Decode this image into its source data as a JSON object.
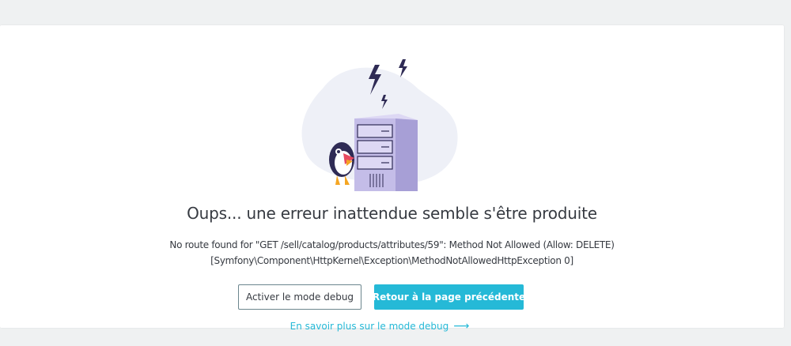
{
  "error": {
    "title": "Oups... une erreur inattendue semble s'être produite",
    "message_line1": "No route found for \"GET /sell/catalog/products/attributes/59\": Method Not Allowed (Allow: DELETE)",
    "message_line2": "[Symfony\\Component\\HttpKernel\\Exception\\MethodNotAllowedHttpException 0]"
  },
  "actions": {
    "debug_label": "Activer le mode debug",
    "back_label": "Retour à la page précédente",
    "learn_more_label": "En savoir plus sur le mode debug",
    "learn_more_icon": "arrow-right-icon"
  },
  "illustration": {
    "name": "server-error-illustration",
    "colors": {
      "blob": "#eef0f7",
      "server": "#c4bde8",
      "server_dark": "#a79fd6",
      "lightning": "#2f2b55"
    }
  },
  "colors": {
    "accent": "#25b9d7",
    "text": "#363a41",
    "background": "#eff1f2"
  }
}
